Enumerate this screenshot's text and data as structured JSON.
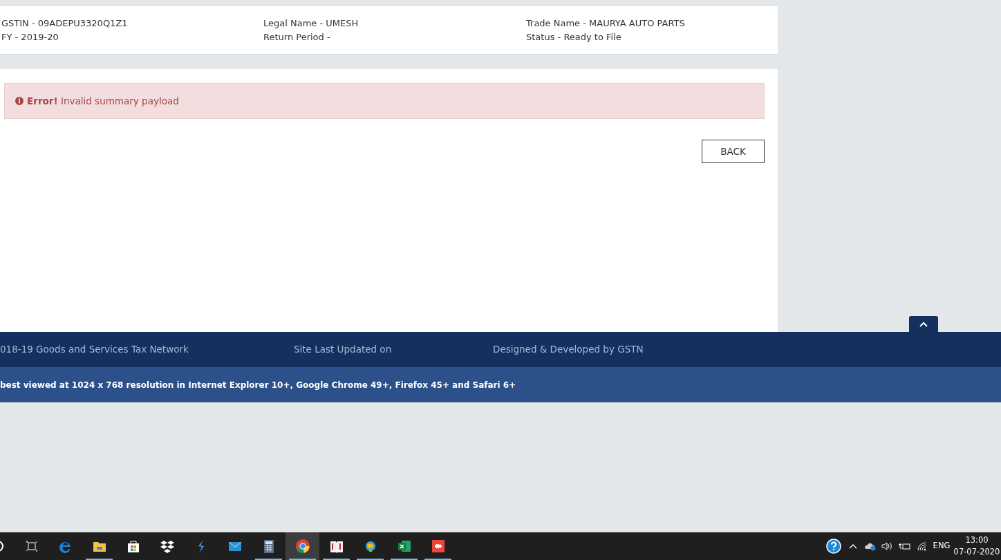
{
  "header": {
    "columns": [
      [
        "GSTIN - 09ADEPU3320Q1Z1",
        "FY - 2019-20"
      ],
      [
        "Legal Name - UMESH",
        "Return Period -"
      ],
      [
        "Trade Name - MAURYA AUTO PARTS",
        "Status - Ready to File"
      ]
    ]
  },
  "alert": {
    "title": "Error!",
    "message": "Invalid summary payload"
  },
  "back_button": "BACK",
  "footer": {
    "copyright": "018-19 Goods and Services Tax Network",
    "updated": "Site Last Updated on",
    "developer": "Designed & Developed by GSTN",
    "note": "best viewed at 1024 x 768 resolution in Internet Explorer 10+, Google Chrome 49+, Firefox 45+ and Safari 6+"
  },
  "taskbar": {
    "apps": [
      {
        "kind": "search",
        "running": false,
        "selected": false
      },
      {
        "kind": "taskview",
        "running": false,
        "selected": false
      },
      {
        "kind": "edge",
        "running": false,
        "selected": false
      },
      {
        "kind": "folder",
        "running": true,
        "selected": false
      },
      {
        "kind": "store",
        "running": false,
        "selected": false
      },
      {
        "kind": "dropbox",
        "running": false,
        "selected": false
      },
      {
        "kind": "bolt",
        "running": false,
        "selected": false
      },
      {
        "kind": "mail",
        "running": false,
        "selected": false
      },
      {
        "kind": "calculator",
        "running": true,
        "selected": false
      },
      {
        "kind": "chrome",
        "running": true,
        "selected": true
      },
      {
        "kind": "book",
        "running": true,
        "selected": false
      },
      {
        "kind": "globe",
        "running": true,
        "selected": false
      },
      {
        "kind": "excel",
        "running": true,
        "selected": false
      },
      {
        "kind": "remote",
        "running": true,
        "selected": false
      }
    ],
    "language": "ENG",
    "time": "13:00",
    "date": "07-07-2020"
  }
}
